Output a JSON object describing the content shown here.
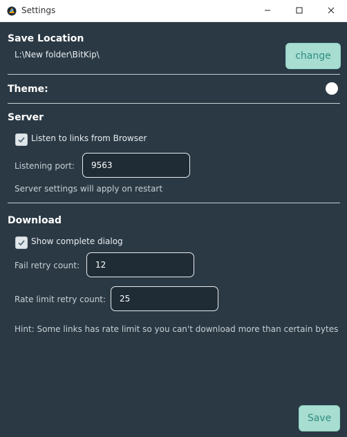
{
  "window": {
    "title": "Settings"
  },
  "save_location": {
    "title": "Save Location",
    "path": "L:\\New folder\\BitKip\\",
    "change_label": "change"
  },
  "theme": {
    "label": "Theme:"
  },
  "server": {
    "title": "Server",
    "listen_label": "Listen to links from Browser",
    "listen_checked": true,
    "port_label": "Listening port:",
    "port_value": "9563",
    "restart_note": "Server settings will apply on restart"
  },
  "download": {
    "title": "Download",
    "show_dialog_label": "Show complete dialog",
    "show_dialog_checked": true,
    "fail_retry_label": "Fail retry count:",
    "fail_retry_value": "12",
    "rate_limit_label": "Rate limit retry count:",
    "rate_limit_value": "25",
    "hint": "Hint: Some links has rate limit so you can't download more than certain bytes"
  },
  "footer": {
    "save_label": "Save"
  },
  "icons": {
    "app": "app-logo-icon",
    "minimize": "minimize-icon",
    "maximize": "maximize-icon",
    "close": "close-icon",
    "check": "check-icon"
  },
  "colors": {
    "background": "#2b3944",
    "input_bg": "#1f2c36",
    "accent_button": "#a8ddd2",
    "accent_text": "#2f8d7e"
  }
}
